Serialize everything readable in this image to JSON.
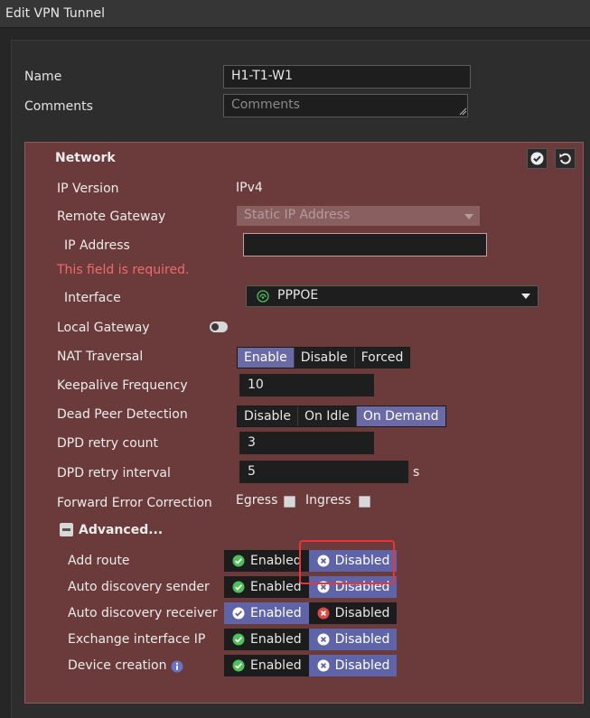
{
  "window": {
    "title": "Edit VPN Tunnel"
  },
  "form": {
    "name_label": "Name",
    "name_value": "H1-T1-W1",
    "comments_label": "Comments",
    "comments_placeholder": "Comments"
  },
  "network": {
    "section_title": "Network",
    "ip_version_label": "IP Version",
    "ip_version_value": "IPv4",
    "remote_gateway_label": "Remote Gateway",
    "remote_gateway_value": "Static IP Address",
    "ip_address_label": "IP Address",
    "ip_address_value": "",
    "error_text": "This field is required.",
    "interface_label": "Interface",
    "interface_value": "PPPOE",
    "local_gateway_label": "Local Gateway",
    "nat_traversal_label": "NAT Traversal",
    "nat_traversal_options": [
      "Enable",
      "Disable",
      "Forced"
    ],
    "nat_traversal_selected": "Enable",
    "keepalive_label": "Keepalive Frequency",
    "keepalive_value": "10",
    "dpd_label": "Dead Peer Detection",
    "dpd_options": [
      "Disable",
      "On Idle",
      "On Demand"
    ],
    "dpd_selected": "On Demand",
    "dpd_retry_count_label": "DPD retry count",
    "dpd_retry_count_value": "3",
    "dpd_retry_interval_label": "DPD retry interval",
    "dpd_retry_interval_value": "5",
    "dpd_retry_interval_unit": "s",
    "fec_label": "Forward Error Correction",
    "fec_egress_label": "Egress",
    "fec_ingress_label": "Ingress"
  },
  "advanced": {
    "title": "Advanced...",
    "rows": [
      {
        "label": "Add route",
        "enabled": "Enabled",
        "disabled": "Disabled",
        "selected": "Disabled"
      },
      {
        "label": "Auto discovery sender",
        "enabled": "Enabled",
        "disabled": "Disabled",
        "selected": "Disabled"
      },
      {
        "label": "Auto discovery receiver",
        "enabled": "Enabled",
        "disabled": "Disabled",
        "selected": "Enabled"
      },
      {
        "label": "Exchange interface IP",
        "enabled": "Enabled",
        "disabled": "Disabled",
        "selected": "Disabled"
      },
      {
        "label": "Device creation",
        "enabled": "Enabled",
        "disabled": "Disabled",
        "selected": "Disabled"
      }
    ]
  },
  "colors": {
    "panel": "#6b3b3b",
    "selected": "#6a6aa6",
    "error": "#f06a6a",
    "highlight": "#e8343a",
    "check_green": "#4fbf5a",
    "x_red": "#e04848"
  }
}
